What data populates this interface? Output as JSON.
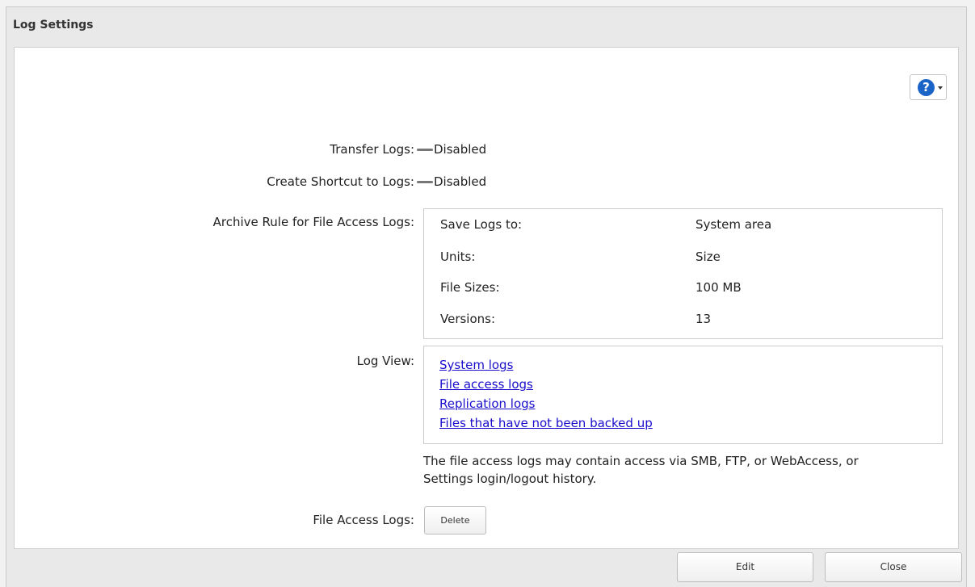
{
  "window": {
    "title": "Log Settings"
  },
  "help": {
    "icon": "help-circle-icon",
    "glyph": "?"
  },
  "settings": {
    "transfer_logs": {
      "label": "Transfer Logs:",
      "value": "Disabled"
    },
    "create_shortcut": {
      "label": "Create Shortcut to Logs:",
      "value": "Disabled"
    },
    "archive_rule": {
      "label": "Archive Rule for File Access Logs:",
      "rows": [
        {
          "key": "Save Logs to:",
          "value": "System area"
        },
        {
          "key": "Units:",
          "value": "Size"
        },
        {
          "key": "File Sizes:",
          "value": "100 MB"
        },
        {
          "key": "Versions:",
          "value": "13"
        }
      ]
    },
    "log_view": {
      "label": "Log View:",
      "links": [
        "System logs",
        "File access logs",
        "Replication logs",
        "Files that have not been backed up"
      ],
      "note_line1": "The file access logs may contain access via SMB, FTP, or WebAccess, or",
      "note_line2": "Settings login/logout history."
    },
    "file_access_logs": {
      "label": "File Access Logs:",
      "delete_label": "Delete"
    }
  },
  "footer": {
    "edit_label": "Edit",
    "close_label": "Close"
  },
  "colors": {
    "link": "#1a0dcc",
    "help_icon": "#1a63c7",
    "disabled_dash": "#777777"
  }
}
